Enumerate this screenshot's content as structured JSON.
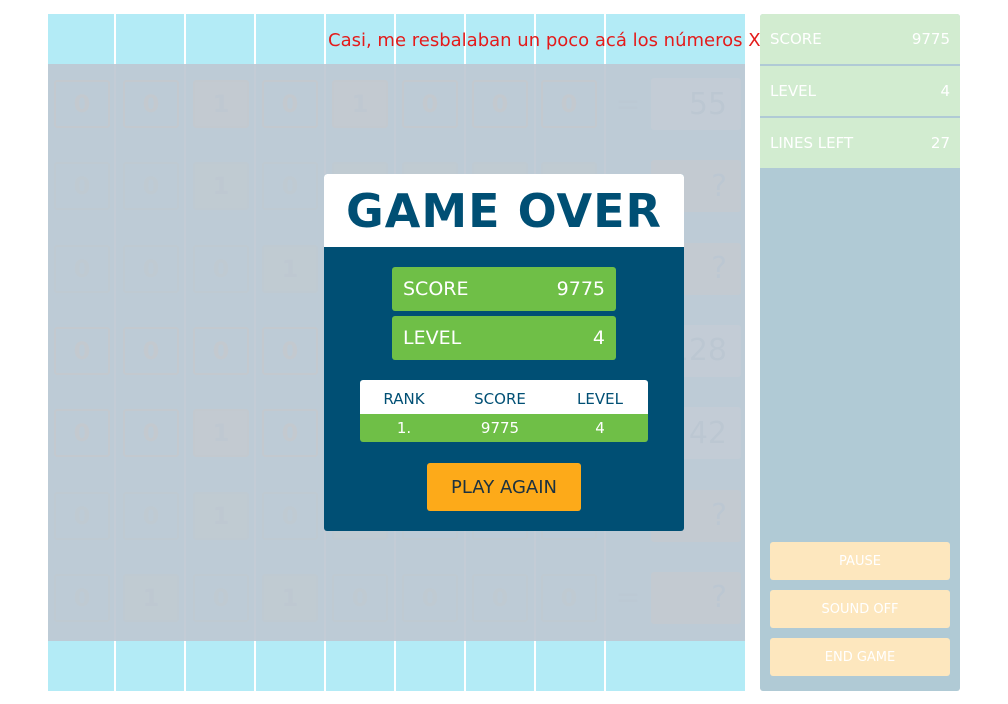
{
  "glitch_text": "Casi, me resbalaban un poco acá los números XD",
  "board": {
    "rows": [
      {
        "bits": [
          "0",
          "0",
          "1",
          "0",
          "1",
          "0",
          "0",
          "0"
        ],
        "bit_styles": [
          "o",
          "o",
          "o",
          "o",
          "o",
          "o",
          "o",
          "o"
        ],
        "equals": "=",
        "target": "55",
        "target_style": "white"
      },
      {
        "bits": [
          "0",
          "0",
          "1",
          "0",
          "1",
          "1",
          "1",
          "1"
        ],
        "bit_styles": [
          "g",
          "g",
          "g",
          "g",
          "g",
          "g",
          "g",
          "g"
        ],
        "equals": "=",
        "target": "?",
        "target_style": "orange"
      },
      {
        "bits": [
          "0",
          "0",
          "0",
          "1",
          "0",
          "0",
          "0",
          "0"
        ],
        "bit_styles": [
          "g",
          "g",
          "g",
          "g",
          "g",
          "g",
          "g",
          "g"
        ],
        "equals": "=",
        "target": "?",
        "target_style": "orange"
      },
      {
        "bits": [
          "0",
          "0",
          "0",
          "0",
          "0",
          "0",
          "0",
          "0"
        ],
        "bit_styles": [
          "o",
          "o",
          "o",
          "o",
          "o",
          "o",
          "o",
          "o"
        ],
        "equals": "=",
        "target": "128",
        "target_style": "white"
      },
      {
        "bits": [
          "0",
          "0",
          "1",
          "0",
          "0",
          "0",
          "0",
          "0"
        ],
        "bit_styles": [
          "o",
          "o",
          "o",
          "o",
          "o",
          "o",
          "o",
          "o"
        ],
        "equals": "=",
        "target": "42",
        "target_style": "white"
      },
      {
        "bits": [
          "0",
          "0",
          "1",
          "0",
          "1",
          "0",
          "0",
          "0"
        ],
        "bit_styles": [
          "g",
          "g",
          "g",
          "g",
          "g",
          "g",
          "g",
          "g"
        ],
        "equals": "=",
        "target": "?",
        "target_style": "orange"
      },
      {
        "bits": [
          "0",
          "1",
          "0",
          "1",
          "0",
          "0",
          "0",
          "0"
        ],
        "bit_styles": [
          "g",
          "g",
          "g",
          "g",
          "g",
          "g",
          "g",
          "g"
        ],
        "equals": "=",
        "target": "?",
        "target_style": "orange"
      }
    ]
  },
  "sidebar": {
    "stats": [
      {
        "label": "SCORE",
        "value": "9775"
      },
      {
        "label": "LEVEL",
        "value": "4"
      },
      {
        "label": "LINES LEFT",
        "value": "27"
      }
    ],
    "pause_label": "PAUSE",
    "sound_label": "SOUND OFF",
    "end_label": "END GAME"
  },
  "modal": {
    "title": "GAME OVER",
    "score_label": "SCORE",
    "score_value": "9775",
    "level_label": "LEVEL",
    "level_value": "4",
    "table": {
      "headers": [
        "RANK",
        "SCORE",
        "LEVEL"
      ],
      "rows": [
        [
          "1.",
          "9775",
          "4"
        ]
      ]
    },
    "play_again_label": "PLAY AGAIN"
  },
  "colors": {
    "board_bg": "#b3ebf6",
    "overlay": "#bec8d2",
    "modal_bg": "#004f74",
    "accent_green": "#6fbf47",
    "accent_orange": "#fdaa19",
    "sidebar_bg": "#b0cad5",
    "glitch_red": "#e41b1b"
  }
}
